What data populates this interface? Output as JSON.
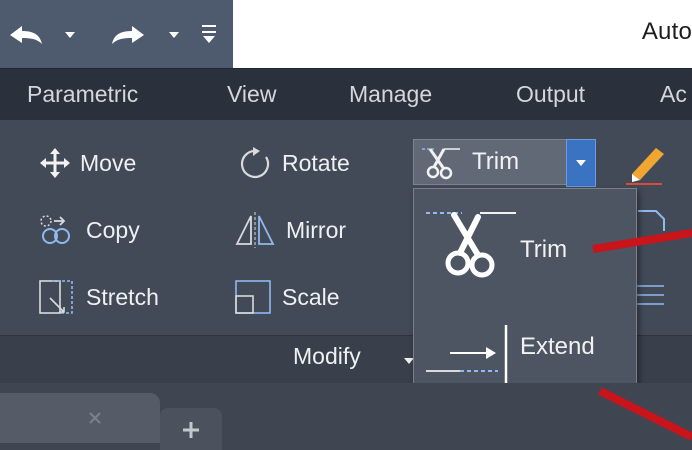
{
  "app": {
    "title": "Auto"
  },
  "quick_access": {
    "icons": [
      "undo-icon",
      "redo-icon",
      "customize-icon"
    ]
  },
  "ribbon_tabs": [
    "Parametric",
    "View",
    "Manage",
    "Output",
    "Ac"
  ],
  "modify_panel": {
    "label": "Modify",
    "commands": {
      "move": "Move",
      "rotate": "Rotate",
      "copy": "Copy",
      "mirror": "Mirror",
      "stretch": "Stretch",
      "scale": "Scale"
    },
    "trim_button": "Trim"
  },
  "dropdown": {
    "items": [
      {
        "label": "Trim",
        "icon": "trim-icon"
      },
      {
        "label": "Extend",
        "icon": "extend-icon"
      }
    ]
  },
  "colors": {
    "accent": "#3a73c2",
    "annotation": "#c8141a",
    "ribbon": "#434a57"
  }
}
